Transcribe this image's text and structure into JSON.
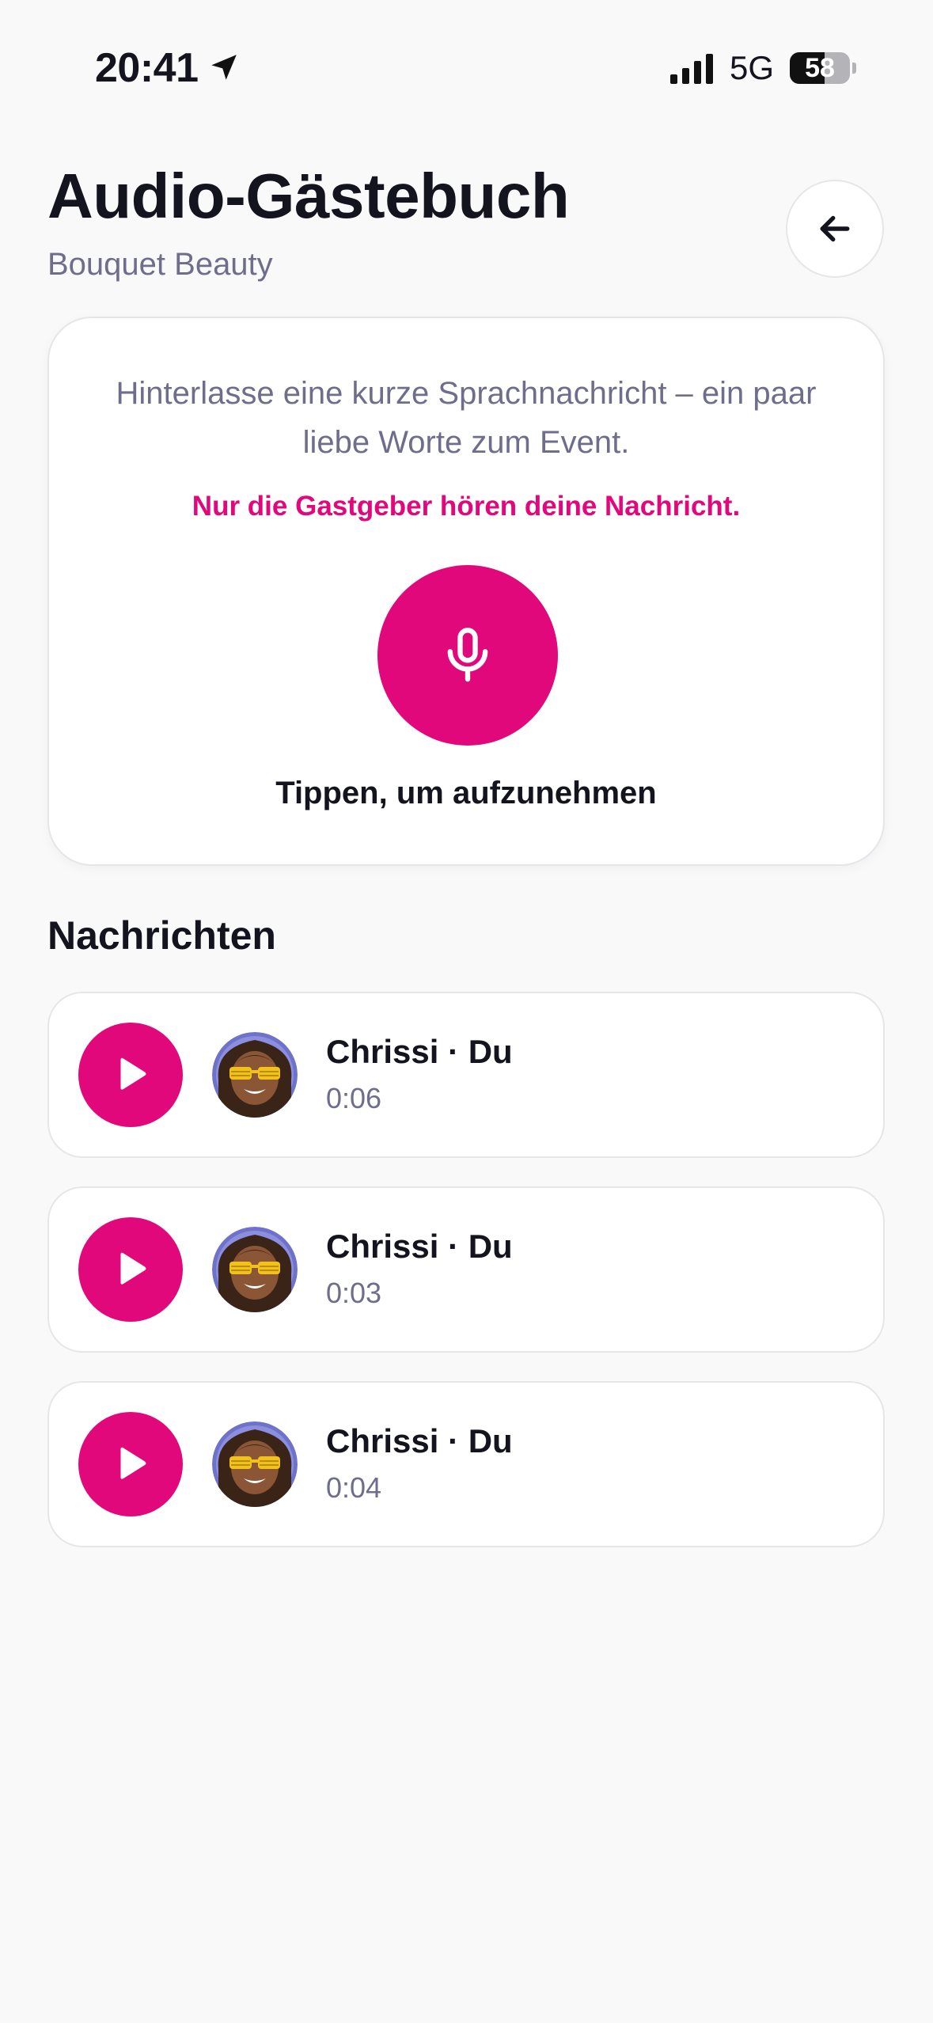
{
  "status_bar": {
    "time": "20:41",
    "network": "5G",
    "battery_level": "58",
    "battery_fraction": 0.58
  },
  "header": {
    "title": "Audio-Gästebuch",
    "subtitle": "Bouquet Beauty",
    "back_icon": "arrow-left-icon"
  },
  "recorder": {
    "instructions": "Hinterlasse eine kurze Sprachnachricht – ein paar liebe Worte zum Event.",
    "privacy_note": "Nur die Gastgeber hören deine Nachricht.",
    "button_icon": "microphone-icon",
    "label": "Tippen, um aufzunehmen"
  },
  "messages_section": {
    "title": "Nachrichten",
    "items": [
      {
        "author": "Chrissi · Du",
        "duration": "0:06"
      },
      {
        "author": "Chrissi · Du",
        "duration": "0:03"
      },
      {
        "author": "Chrissi · Du",
        "duration": "0:04"
      }
    ]
  },
  "colors": {
    "accent": "#e0087a",
    "background": "#f9f9f9",
    "card": "#ffffff",
    "muted_text": "#6e6e8c",
    "text": "#14141f"
  }
}
